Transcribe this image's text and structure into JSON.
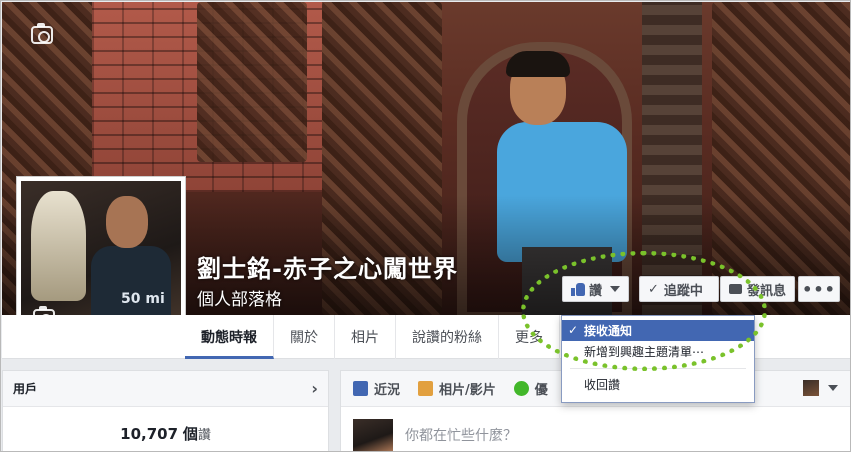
{
  "profile": {
    "name": "劉士銘-赤子之心闖世界",
    "subtitle": "個人部落格",
    "avatar_label": "50 mi"
  },
  "cover_actions": {
    "like_label": "讚",
    "following_label": "追蹤中",
    "message_label": "發訊息",
    "more_label": "•••"
  },
  "tabs": [
    {
      "label": "動態時報",
      "active": true
    },
    {
      "label": "關於",
      "active": false
    },
    {
      "label": "相片",
      "active": false
    },
    {
      "label": "說讚的粉絲",
      "active": false
    },
    {
      "label": "更多",
      "active": false
    }
  ],
  "dropdown": {
    "items": [
      {
        "label": "接收通知",
        "selected": true
      },
      {
        "label": "新增到興趣主題清單⋯",
        "selected": false
      },
      {
        "label": "收回讚",
        "selected": false
      }
    ]
  },
  "left_panel": {
    "title": "用戶",
    "count": "10,707",
    "count_unit": "個",
    "count_suffix": "讚"
  },
  "composer": {
    "tabs": [
      {
        "label": "近況",
        "icon": "pencil-icon",
        "color": "#4267b2"
      },
      {
        "label": "相片/影片",
        "icon": "photo-icon",
        "color": "#e2a03f"
      },
      {
        "label": "優",
        "icon": "offer-icon",
        "color": "#42b72a"
      }
    ],
    "placeholder": "你都在忙些什麼？"
  },
  "colors": {
    "accent": "#4267b2",
    "highlight": "#7ac22b"
  }
}
